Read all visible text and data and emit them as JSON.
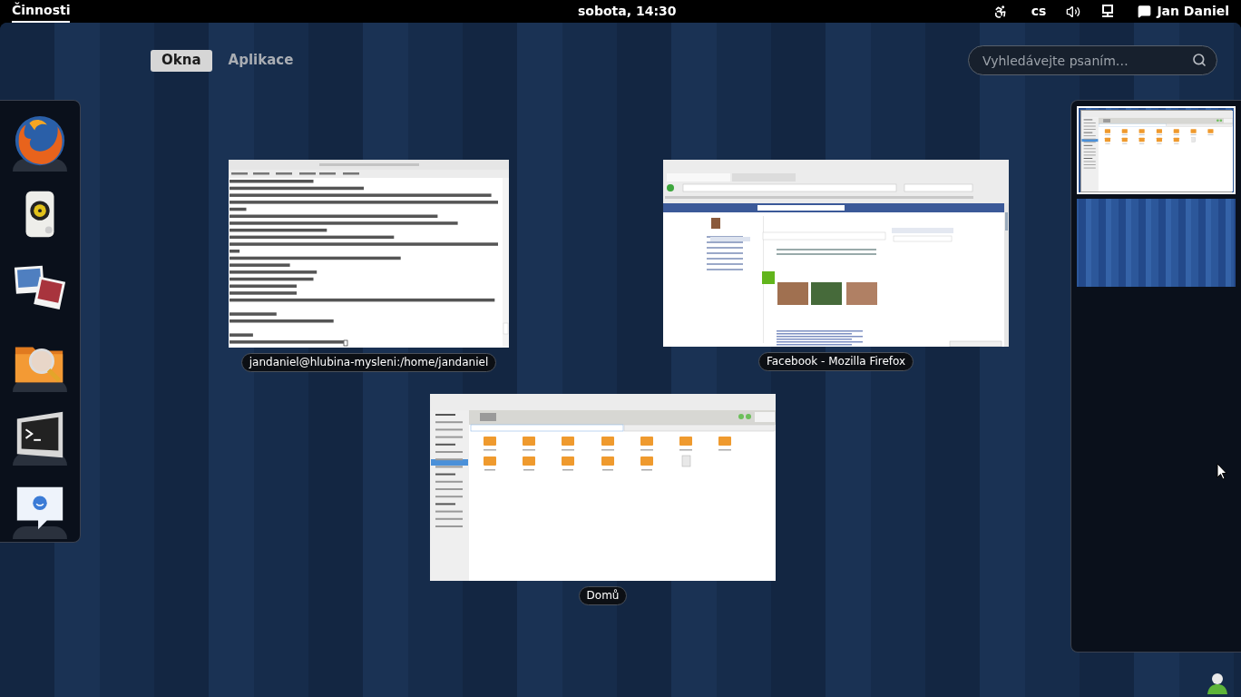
{
  "top_bar": {
    "activities": {
      "label": "Činnosti",
      "selected": true
    },
    "clock": "sobota, 14:30",
    "keyboard_layout": "cs",
    "user": "Jan Daniel"
  },
  "view_tabs": [
    {
      "label": "Okna",
      "selected": true
    },
    {
      "label": "Aplikace",
      "selected": false
    }
  ],
  "search": {
    "placeholder": "Vyhledávejte psaním…"
  },
  "dash": [
    {
      "kind": "browser",
      "running": true
    },
    {
      "kind": "music",
      "running": false
    },
    {
      "kind": "photos",
      "running": false
    },
    {
      "kind": "files",
      "running": true
    },
    {
      "kind": "terminal",
      "running": true
    },
    {
      "kind": "chat",
      "running": true
    }
  ],
  "windows": [
    {
      "kind": "terminal",
      "caption": "jandaniel@hlubina-mysleni:/home/jandaniel"
    },
    {
      "kind": "browser",
      "caption": "Facebook - Mozilla Firefox"
    },
    {
      "kind": "files",
      "caption": "Domů"
    }
  ],
  "workspaces": [
    {
      "selected": true,
      "has_window": true
    },
    {
      "selected": false,
      "has_window": false
    }
  ]
}
